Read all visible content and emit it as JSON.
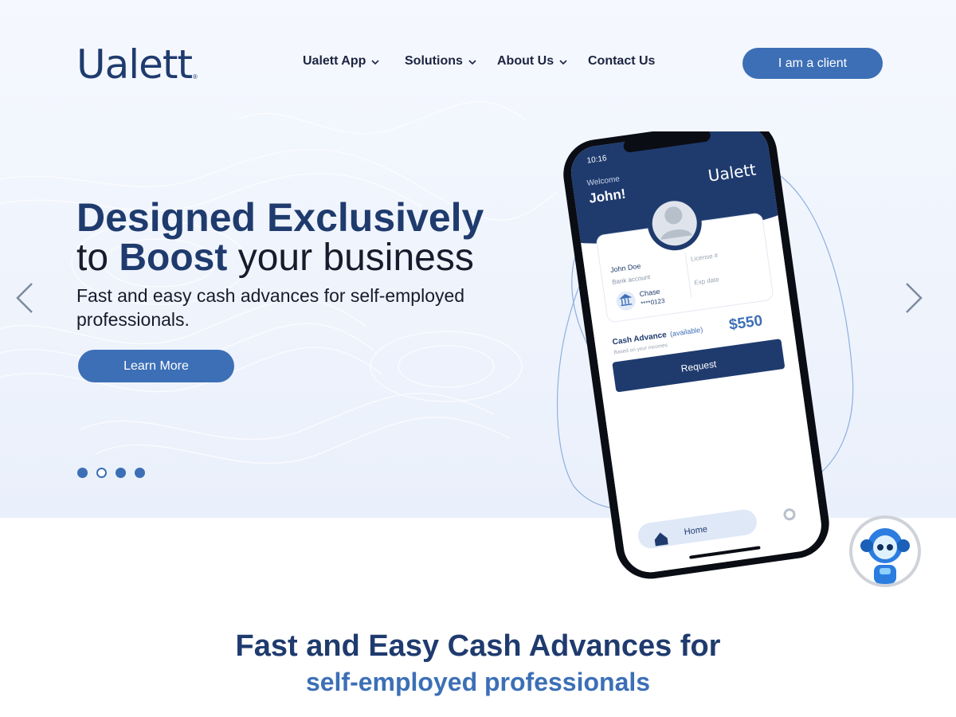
{
  "brand": {
    "logo_text": "Ualett",
    "reg_mark": "®"
  },
  "nav": {
    "items": [
      {
        "label": "Ualett App",
        "has_dropdown": true
      },
      {
        "label": "Solutions",
        "has_dropdown": true
      },
      {
        "label": "About Us",
        "has_dropdown": true
      },
      {
        "label": "Contact Us",
        "has_dropdown": false
      }
    ],
    "client_button": "I am a client"
  },
  "hero": {
    "headline_1": "Designed Exclusively",
    "headline_2_pre": "to ",
    "headline_2_hl": "Boost",
    "headline_2_post": " your business",
    "subtitle": "Fast and easy cash advances for self-employed professionals.",
    "cta": "Learn More",
    "slides": {
      "count": 4,
      "active": 2
    }
  },
  "phone": {
    "status_time": "10:16",
    "welcome": "Welcome",
    "user_name": "John!",
    "brand": "Ualett",
    "card_name": "John Doe",
    "bank_account_label": "Bank account",
    "bank_name": "Chase",
    "bank_number": "****0123",
    "license_label": "License #",
    "exp_label": "Exp date",
    "cash_advance_label": "Cash Advance",
    "available_label": "(available)",
    "based_on": "Based on your incomes",
    "amount": "$550",
    "request_button": "Request",
    "home_tab": "Home"
  },
  "section": {
    "title": "Fast and Easy Cash Advances for",
    "subtitle": "self-employed professionals"
  },
  "colors": {
    "primary": "#3c6fb6",
    "navy": "#1f3b6e",
    "hero_bg": "#eaf0fb"
  }
}
